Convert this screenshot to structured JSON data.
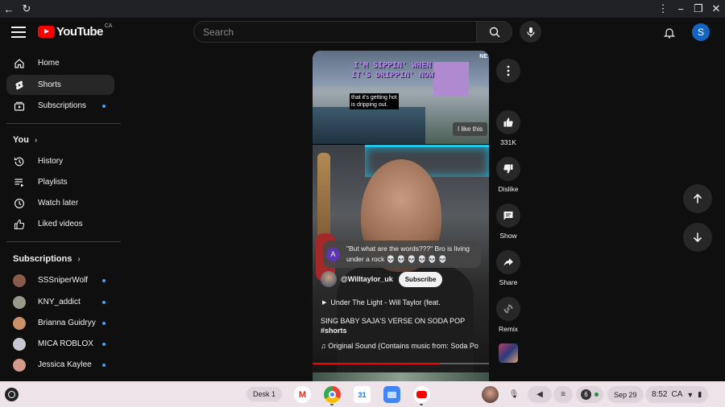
{
  "header": {
    "logo_text": "YouTube",
    "logo_country": "CA",
    "search_placeholder": "Search",
    "avatar_letter": "S"
  },
  "sidebar": {
    "items": [
      {
        "label": "Home",
        "icon": "home-icon"
      },
      {
        "label": "Shorts",
        "icon": "shorts-icon",
        "active": true
      },
      {
        "label": "Subscriptions",
        "icon": "subscriptions-icon",
        "new": true
      }
    ],
    "you_heading": "You",
    "you_items": [
      {
        "label": "History",
        "icon": "history-icon"
      },
      {
        "label": "Playlists",
        "icon": "playlists-icon"
      },
      {
        "label": "Watch later",
        "icon": "watch-later-icon"
      },
      {
        "label": "Liked videos",
        "icon": "like-icon"
      }
    ],
    "subs_heading": "Subscriptions",
    "subscriptions": [
      {
        "name": "SSSniperWolf",
        "color": "#8a5a4a"
      },
      {
        "name": "KNY_addict",
        "color": "#9a9a8a"
      },
      {
        "name": "Brianna Guidryy",
        "color": "#c9906a"
      },
      {
        "name": "MICA ROBLOX",
        "color": "#c7c7d4"
      },
      {
        "name": "Jessica Kaylee",
        "color": "#d59a8a"
      }
    ]
  },
  "short": {
    "ad_title_line1": "I'M SIPPIN' WHEN",
    "ad_title_line2": "IT'S DRIPPIN' NOW",
    "ad_caption_line1": "that it's getting hot",
    "ad_caption_line2": "is dripping out.",
    "ad_badge": "NE",
    "ad_like_label": "I like this",
    "comment_avatar": "A",
    "comment_text_line1": "\"But what are the words???\" Bro is living",
    "comment_text_line2": "under a rock 💀 💀 💀 💀 💀 💀",
    "channel_name": "@Willtaylor_uk",
    "subscribe_label": "Subscribe",
    "music_line": "Under The Light - Will Taylor (feat.",
    "description": "SING BABY SAJA'S VERSE ON SODA POP",
    "hashtag": "#shorts",
    "sound_line": "Original Sound (Contains music from: Soda Po",
    "progress": 0.72
  },
  "actions": {
    "likes": "331K",
    "dislike": "Dislike",
    "comments": "Show",
    "share": "Share",
    "remix": "Remix"
  },
  "shelf": {
    "desk_label": "Desk 1",
    "notif_count": "6",
    "date": "Sep 29",
    "time": "8:52",
    "region": "CA"
  }
}
